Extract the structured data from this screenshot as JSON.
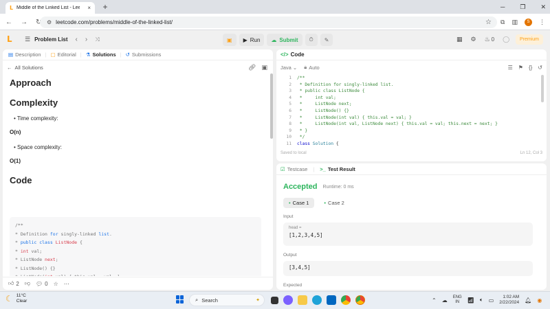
{
  "browser": {
    "tab_title": "Middle of the Linked List - LeetCode",
    "tab_close": "×",
    "new_tab": "+",
    "url": "leetcode.com/problems/middle-of-the-linked-list/",
    "profile_initial": "S"
  },
  "header": {
    "problem_list": "Problem List",
    "run": "Run",
    "submit": "Submit",
    "streak_count": "0",
    "premium": "Premium"
  },
  "left_tabs": [
    "Description",
    "Editorial",
    "Solutions",
    "Submissions"
  ],
  "all_solutions": "All Solutions",
  "solution": {
    "approach": "Approach",
    "complexity": "Complexity",
    "time_label": "Time complexity:",
    "time_value": "O(n)",
    "space_label": "Space complexity:",
    "space_value": "O(1)",
    "code_heading": "Code"
  },
  "left_footer": {
    "votes": "2",
    "comments": "0"
  },
  "code": {
    "panel_title": "Code",
    "language": "Java",
    "mode": "Auto",
    "line_numbers": [
      "1",
      "2",
      "3",
      "4",
      "5",
      "6",
      "7",
      "8",
      "9",
      "10",
      "11"
    ],
    "saved": "Saved to local",
    "cursor": "Ln 12, Col 3"
  },
  "result": {
    "tab_testcase": "Testcase",
    "tab_result": "Test Result",
    "status": "Accepted",
    "runtime": "Runtime: 0 ms",
    "case1": "Case 1",
    "case2": "Case 2",
    "input_label": "Input",
    "input_key": "head =",
    "input_value": "[1,2,3,4,5]",
    "output_label": "Output",
    "output_value": "[3,4,5]",
    "expected_label": "Expected"
  },
  "taskbar": {
    "temp": "11°C",
    "weather": "Clear",
    "search": "Search",
    "lang_top": "ENG",
    "lang_bottom": "IN",
    "time": "1:02 AM",
    "date": "2/22/2024"
  }
}
